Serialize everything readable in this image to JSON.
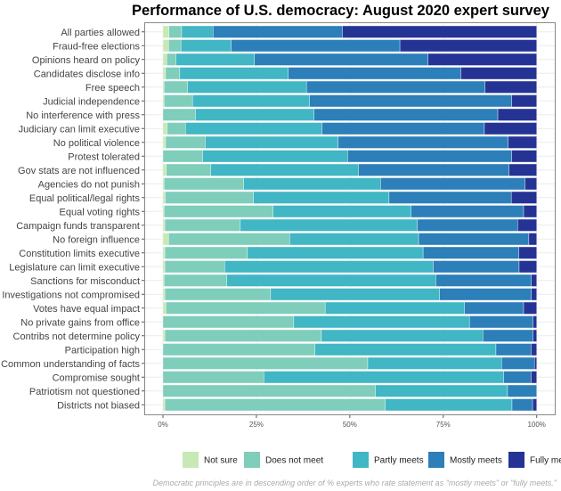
{
  "chart_data": {
    "type": "bar",
    "orientation": "horizontal",
    "stacked": true,
    "title": "Performance of U.S. democracy: August 2020 expert survey",
    "xlabel": "",
    "ylabel": "",
    "xlim": [
      0,
      100
    ],
    "x_ticks": [
      "0%",
      "25%",
      "50%",
      "75%",
      "100%"
    ],
    "grid": true,
    "legend_position": "bottom",
    "caption": "Democratic principles are in descending order of % experts who rate statement as \"mostly meets\" or \"fully meets.\"",
    "categories": [
      "All parties allowed",
      "Fraud-free elections",
      "Opinions heard on policy",
      "Candidates disclose info",
      "Free speech",
      "Judicial independence",
      "No interference with press",
      "Judiciary can limit executive",
      "No political violence",
      "Protest tolerated",
      "Gov stats are not influenced",
      "Agencies do not punish",
      "Equal political/legal rights",
      "Equal voting rights",
      "Campaign funds transparent",
      "No foreign influence",
      "Constitution limits executive",
      "Legislature can limit executive",
      "Sanctions for misconduct",
      "Investigations not compromised",
      "Votes have equal impact",
      "No private gains from office",
      "Contribs not determine policy",
      "Participation high",
      "Common understanding of facts",
      "Compromise sought",
      "Patriotism not questioned",
      "Districts not biased"
    ],
    "series": [
      {
        "name": "Not sure",
        "color": "#c7e9b4",
        "values": [
          1.6,
          1.5,
          1.0,
          0.7,
          0.3,
          0.3,
          0.0,
          1.1,
          0.7,
          0.0,
          0.9,
          0.3,
          0.6,
          0.3,
          0.5,
          1.5,
          0.5,
          0.5,
          0.3,
          0.5,
          0.8,
          0.0,
          0.5,
          0.0,
          0.0,
          0.0,
          0.0,
          0.5
        ]
      },
      {
        "name": "Does not meet",
        "color": "#7fcdbb",
        "values": [
          3.4,
          3.3,
          2.5,
          3.8,
          6.3,
          7.6,
          8.7,
          4.9,
          10.6,
          10.6,
          11.9,
          21.3,
          23.6,
          29.2,
          20.2,
          32.4,
          22.1,
          16.0,
          16.8,
          28.3,
          42.6,
          35.0,
          41.9,
          40.7,
          54.8,
          27.0,
          56.9,
          59.0
        ]
      },
      {
        "name": "Partly meets",
        "color": "#41b6c4",
        "values": [
          8.4,
          13.5,
          21.0,
          29.0,
          31.8,
          31.3,
          31.7,
          36.6,
          35.6,
          38.8,
          39.5,
          36.6,
          36.3,
          36.9,
          47.4,
          34.5,
          47.0,
          55.8,
          55.9,
          45.2,
          37.3,
          47.0,
          43.2,
          48.4,
          35.8,
          64.2,
          35.3,
          33.9
        ]
      },
      {
        "name": "Mostly meets",
        "color": "#2c7fb8",
        "values": [
          34.6,
          45.1,
          46.4,
          46.2,
          47.8,
          54.1,
          49.2,
          43.4,
          45.5,
          43.9,
          40.3,
          38.7,
          32.7,
          30.1,
          26.8,
          29.5,
          25.6,
          23.0,
          25.6,
          24.6,
          15.8,
          17.0,
          13.4,
          9.4,
          8.8,
          7.3,
          7.8,
          5.5
        ]
      },
      {
        "name": "Fully meets",
        "color": "#253494",
        "values": [
          52.0,
          36.6,
          29.1,
          20.3,
          13.8,
          6.7,
          10.4,
          14.0,
          7.6,
          6.7,
          7.4,
          3.1,
          6.8,
          3.5,
          5.1,
          2.1,
          4.8,
          4.7,
          1.4,
          1.4,
          3.5,
          1.0,
          1.0,
          1.5,
          0.6,
          1.5,
          0.0,
          1.1
        ]
      }
    ]
  }
}
